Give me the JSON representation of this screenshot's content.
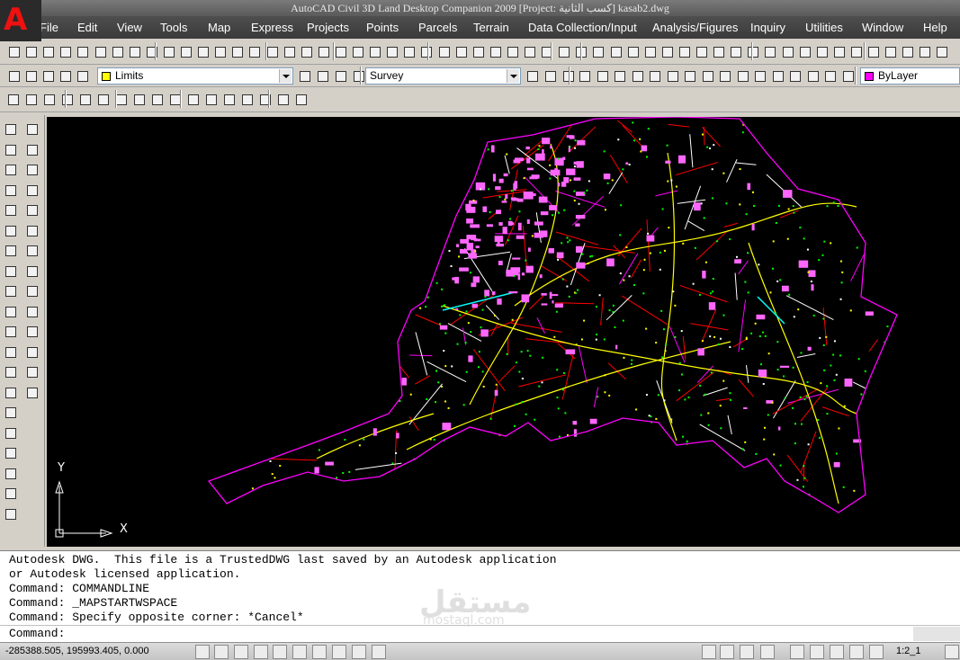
{
  "title": "AutoCAD Civil 3D Land Desktop Companion 2009 [Project: كسب الثانية] kasab2.dwg",
  "menu": [
    "File",
    "Edit",
    "View",
    "Tools",
    "Map",
    "Express",
    "Projects",
    "Points",
    "Parcels",
    "Terrain",
    "Data Collection/Input",
    "Analysis/Figures",
    "Inquiry",
    "Utilities",
    "Window",
    "Help"
  ],
  "layer": {
    "value": "Limits",
    "color": "#ffff00"
  },
  "workspace": {
    "value": "Survey"
  },
  "linetype": {
    "value": "ByLayer",
    "color": "#ff00ff"
  },
  "ucs": {
    "x_label": "X",
    "y_label": "Y"
  },
  "command_history": [
    "Autodesk DWG.  This file is a TrustedDWG last saved by an Autodesk application",
    "or Autodesk licensed application.",
    "Command: COMMANDLINE",
    "Command: _MAPSTARTWSPACE",
    "Command: Specify opposite corner: *Cancel*"
  ],
  "command_prompt": "Command:",
  "watermark": {
    "arabic": "مستقل",
    "latin": "mostaql.com"
  },
  "status": {
    "coordinates": "-285388.505, 195993.405, 0.000",
    "scale": "1:2_1"
  },
  "colors": {
    "canvas": "#000000",
    "parcel": "#ff0000",
    "boundary": "#ff00ff",
    "road": "#ffff00",
    "building": "#ff66ff",
    "point": "#00ff00",
    "channel": "#00ffff"
  }
}
